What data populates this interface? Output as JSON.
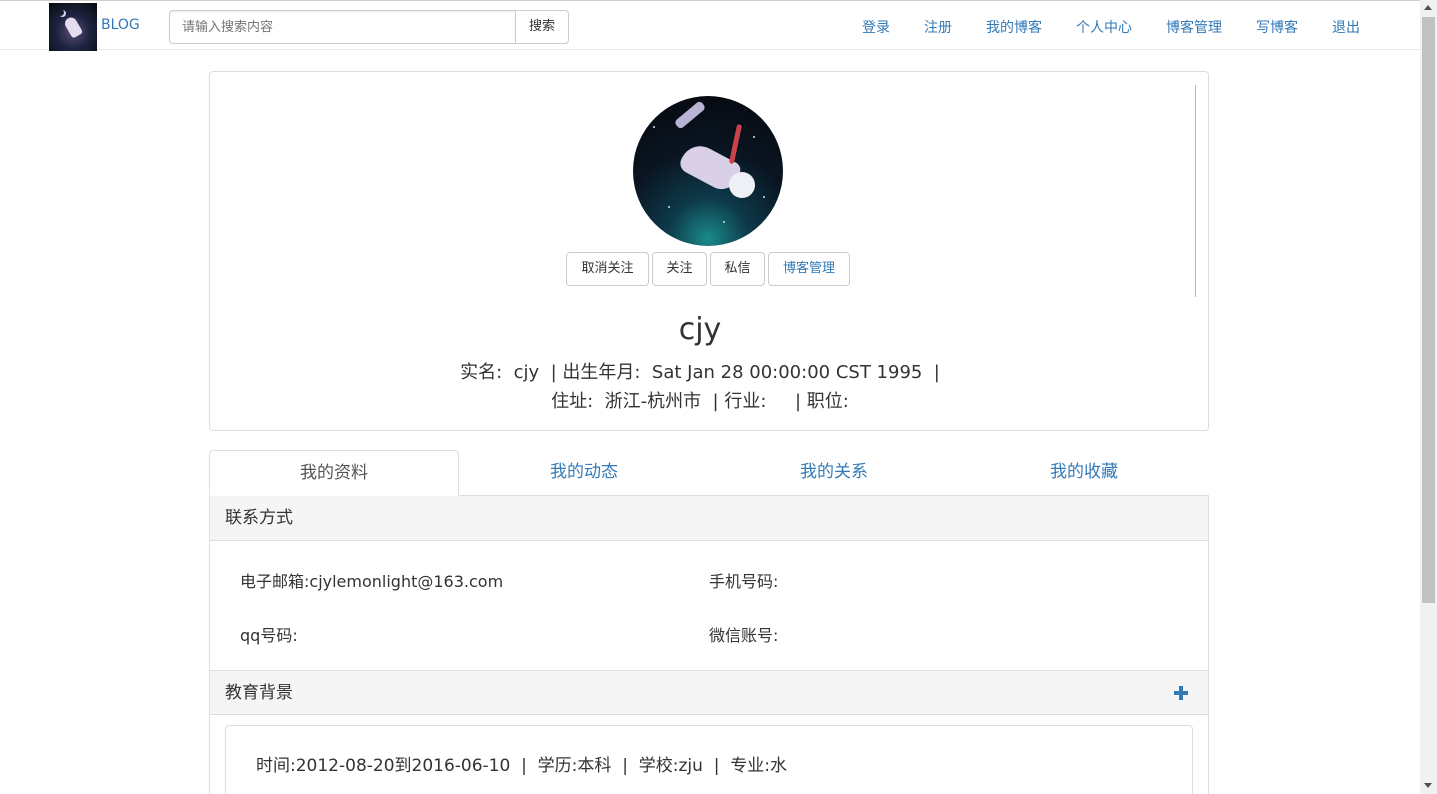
{
  "navbar": {
    "brand": "BLOG",
    "search_placeholder": "请输入搜索内容",
    "search_button": "搜索",
    "links": [
      "登录",
      "注册",
      "我的博客",
      "个人中心",
      "博客管理",
      "写博客",
      "退出"
    ]
  },
  "profile": {
    "buttons": {
      "unfollow": "取消关注",
      "follow": "关注",
      "message": "私信",
      "manage": "博客管理"
    },
    "username": "cjy",
    "info_line_1": "实名:  cjy  | 出生年月:  Sat Jan 28 00:00:00 CST 1995  |",
    "info_line_2": "住址:  浙江-杭州市  | 行业:     | 职位:"
  },
  "tabs": [
    "我的资料",
    "我的动态",
    "我的关系",
    "我的收藏"
  ],
  "contact": {
    "heading": "联系方式",
    "email": "电子邮箱:cjylemonlight@163.com",
    "phone": "手机号码:",
    "qq": "qq号码:",
    "wechat": "微信账号:"
  },
  "education": {
    "heading": "教育背景",
    "entry": "时间:2012-08-20到2016-06-10  |  学历:本科  |  学校:zju  |  专业:水"
  },
  "colors": {
    "link": "#337ab7",
    "text": "#333333",
    "border": "#dddddd",
    "panel_heading_bg": "#f5f5f5"
  },
  "icons": [
    "search-icon",
    "plus-icon",
    "avatar-image",
    "logo-image"
  ]
}
